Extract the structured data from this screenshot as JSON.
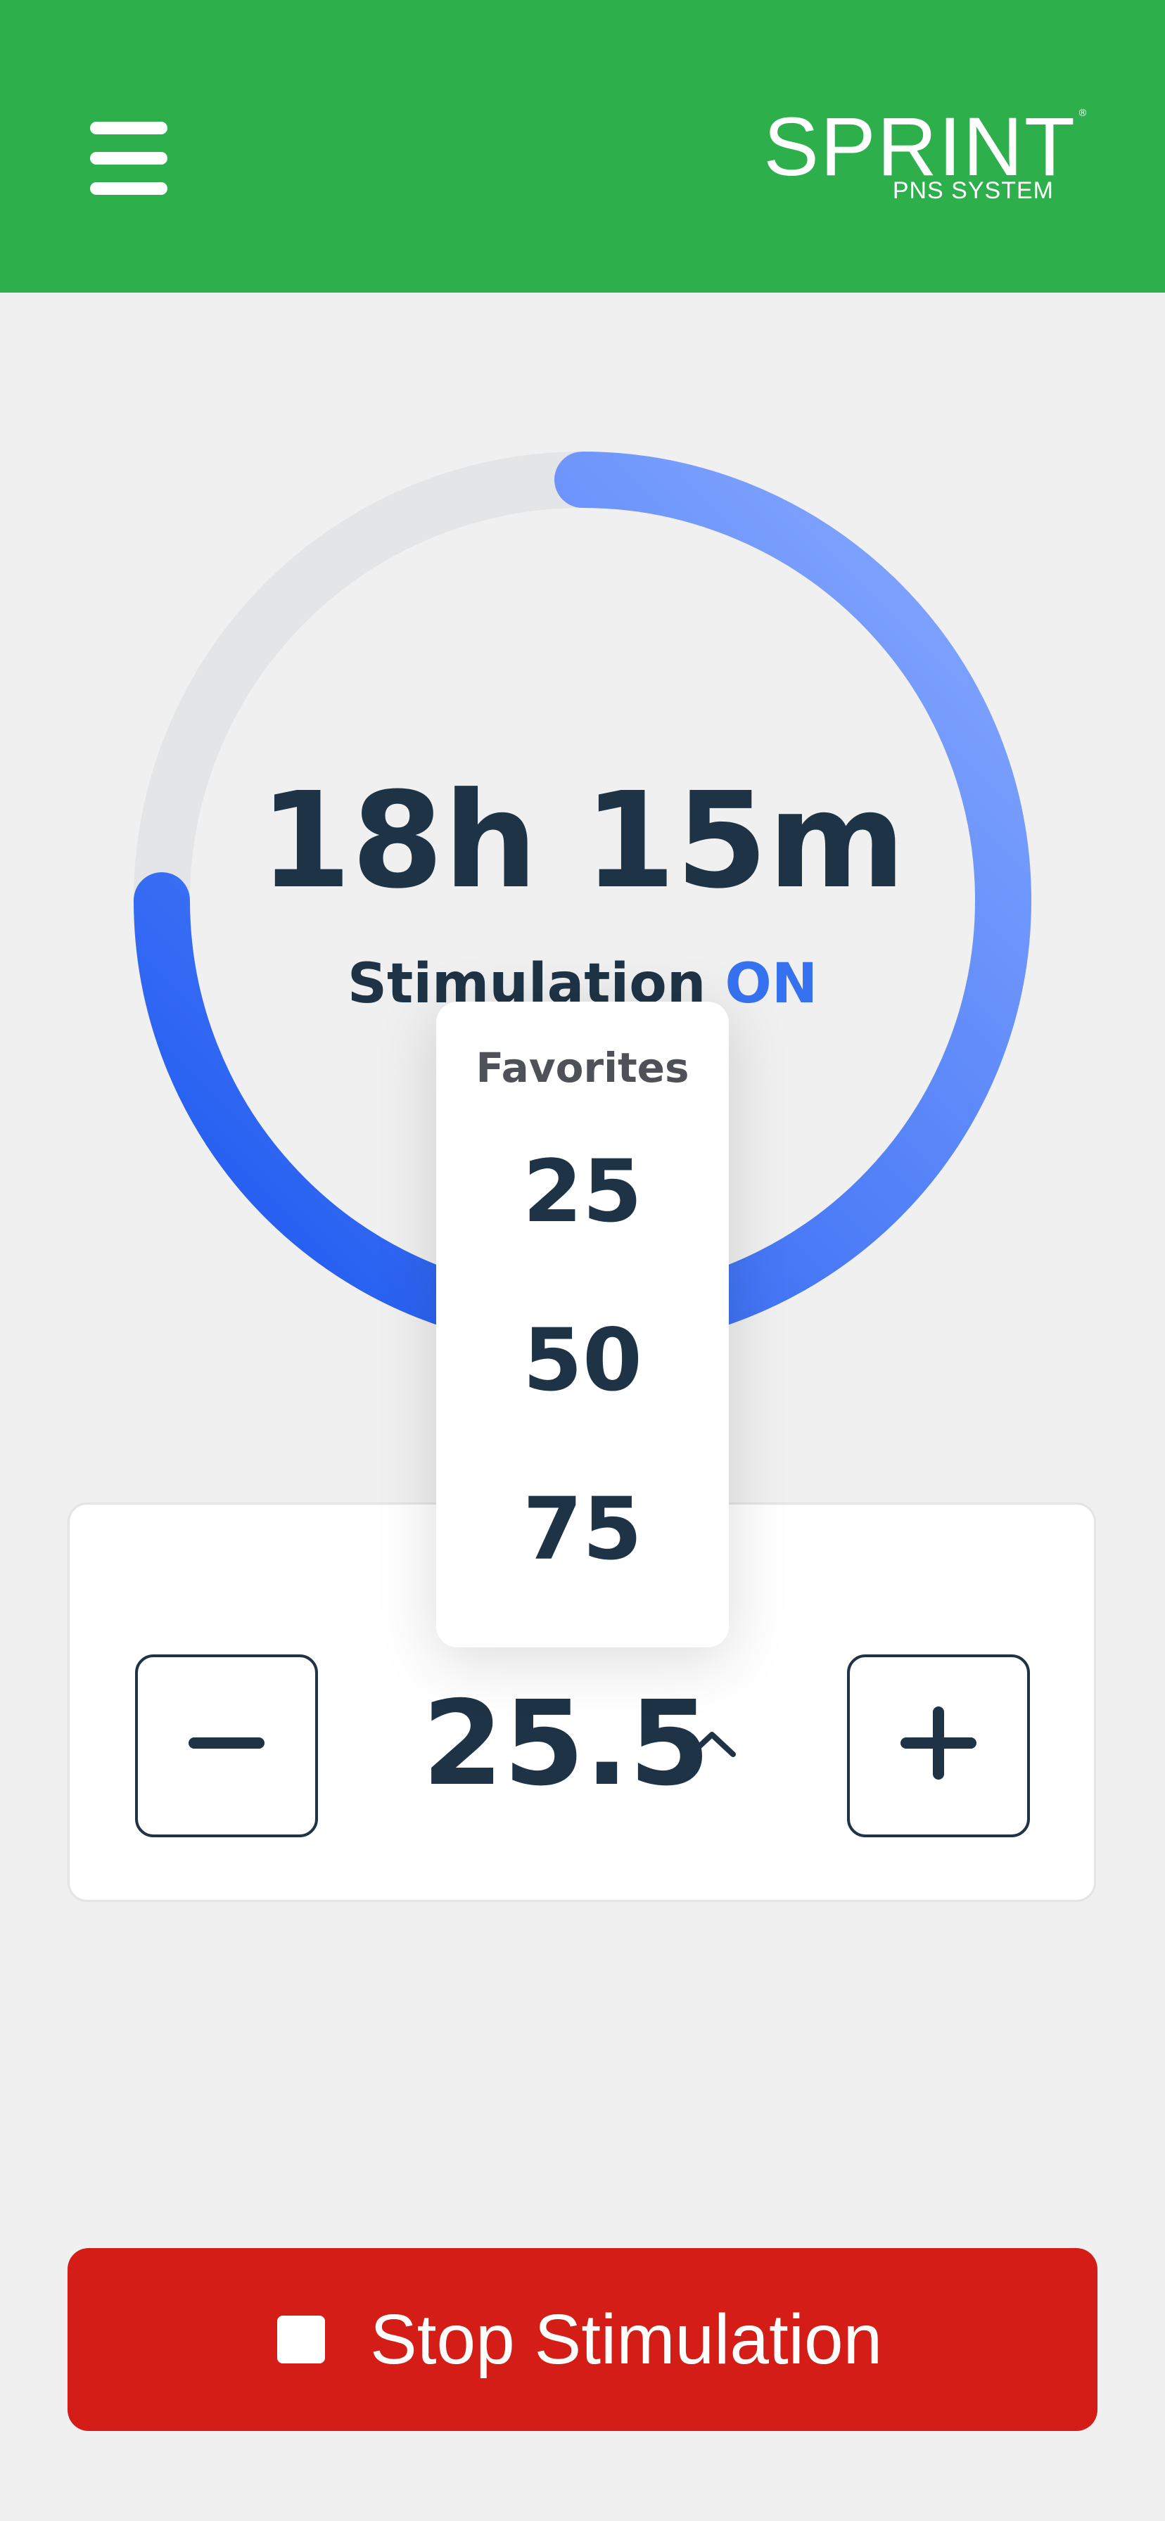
{
  "header": {
    "menu_icon": "hamburger-menu-icon",
    "brand_color": "#2daf4b",
    "logo": {
      "name": "SPRINT",
      "mark": "®",
      "subtitle": "PNS SYSTEM"
    }
  },
  "timer": {
    "value": "18h 15m",
    "status_prefix": "Stimulation",
    "status_state": "ON",
    "progress": 0.75,
    "colors": {
      "track": "#e4e5e6",
      "gradient_start": "#8aabff",
      "gradient_end": "#1a56f0"
    }
  },
  "amplitude": {
    "value": "25.5",
    "decrease_icon": "minus-icon",
    "increase_icon": "plus-icon",
    "expand_icon": "chevron-up-icon"
  },
  "favorites": {
    "title": "Favorites",
    "options": [
      "25",
      "50",
      "75"
    ]
  },
  "stop": {
    "label": "Stop Stimulation",
    "icon": "stop-square-icon",
    "color": "#d31d16"
  }
}
